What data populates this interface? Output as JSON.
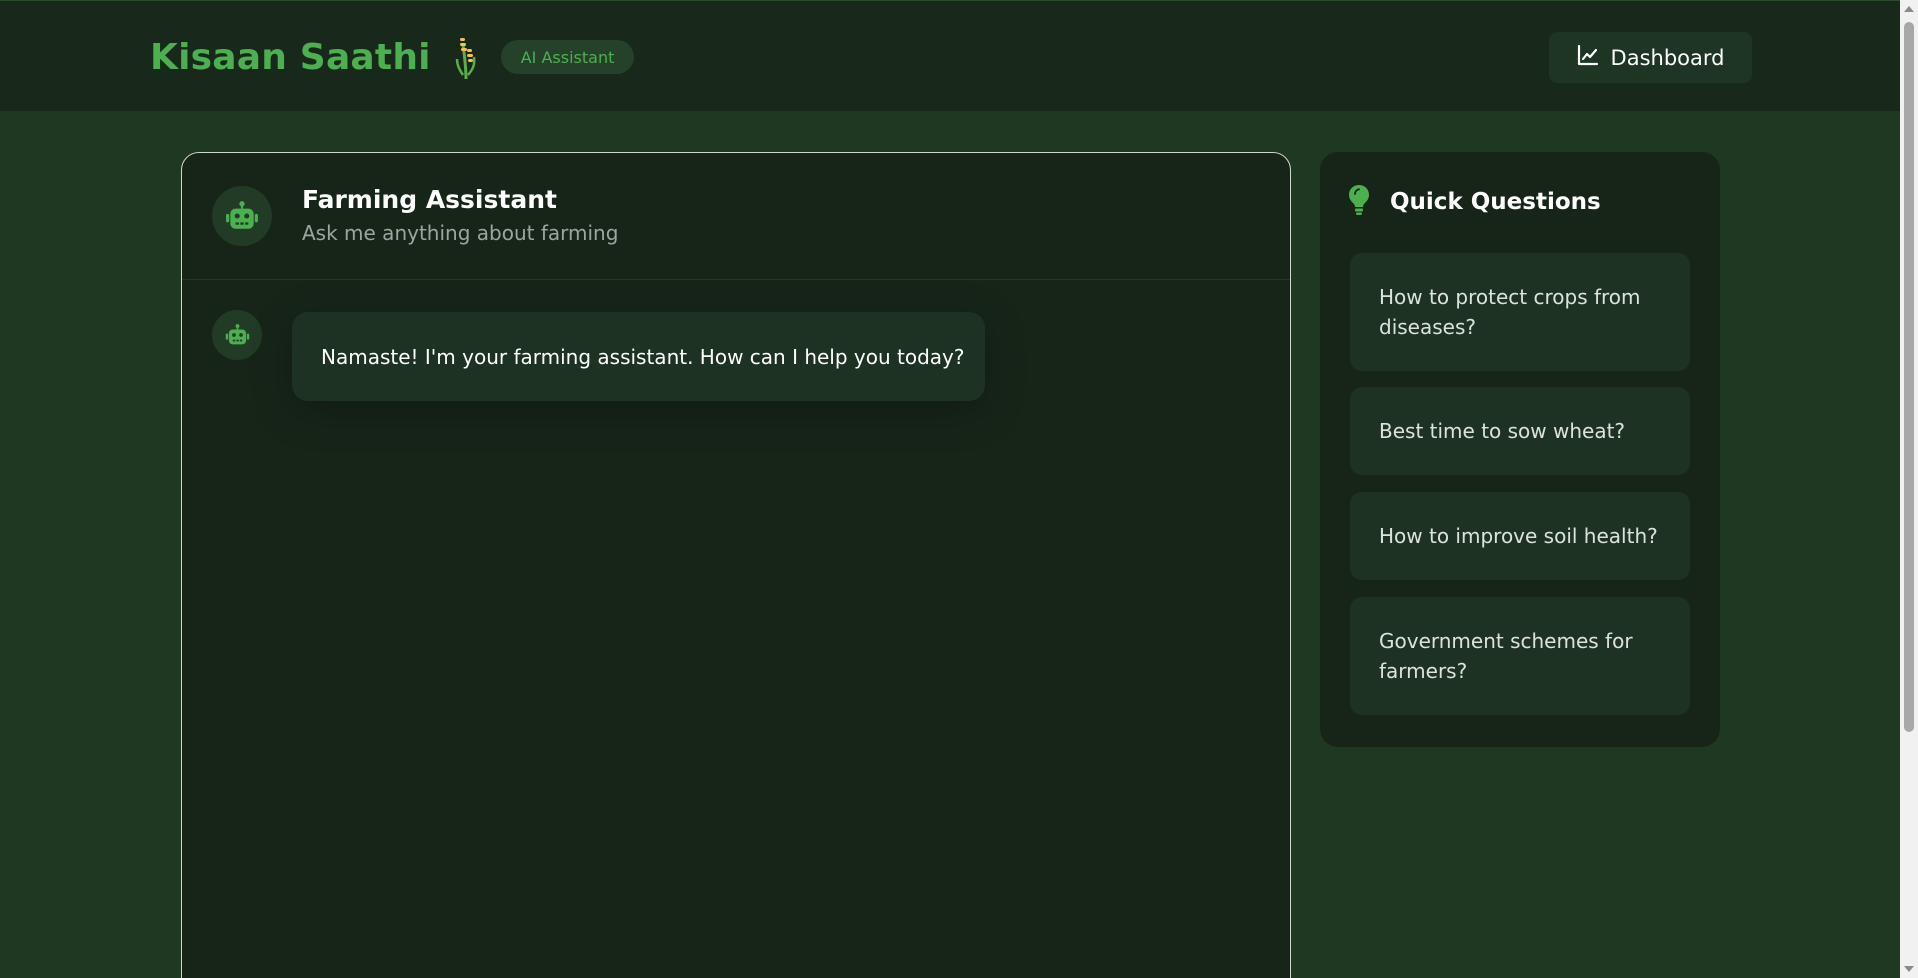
{
  "header": {
    "brand_title": "Kisaan Saathi",
    "brand_icon": "wheat-icon",
    "badge": "AI Assistant",
    "dashboard_label": "Dashboard",
    "dashboard_icon": "chart-line-icon"
  },
  "chat": {
    "title": "Farming Assistant",
    "subtitle": "Ask me anything about farming",
    "avatar_icon": "robot-icon",
    "messages": [
      {
        "sender": "bot",
        "text": "Namaste! I'm your farming assistant. How can I help you today?"
      }
    ]
  },
  "quick_questions": {
    "title": "Quick Questions",
    "icon": "lightbulb-icon",
    "items": [
      "How to protect crops from diseases?",
      "Best time to sow wheat?",
      "How to improve soil health?",
      "Government schemes for farmers?"
    ]
  },
  "colors": {
    "accent": "#4caf50",
    "background": "#1f3822",
    "panel": "#172519",
    "header": "#18281a"
  }
}
